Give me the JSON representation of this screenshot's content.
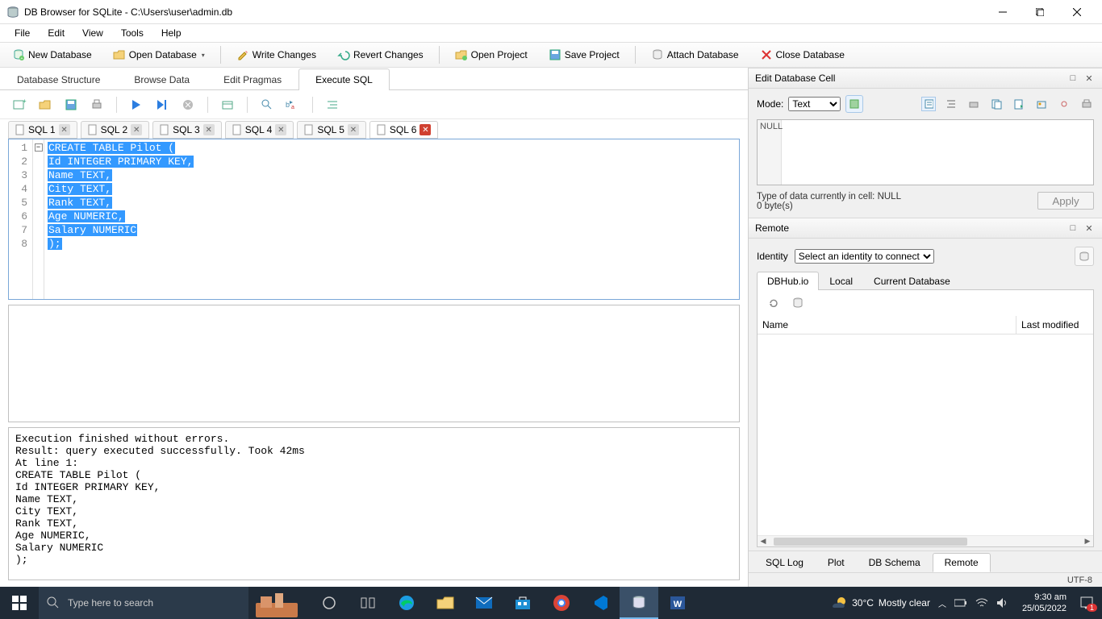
{
  "window": {
    "title": "DB Browser for SQLite - C:\\Users\\user\\admin.db"
  },
  "menu": {
    "file": "File",
    "edit": "Edit",
    "view": "View",
    "tools": "Tools",
    "help": "Help"
  },
  "toolbar": {
    "new_db": "New Database",
    "open_db": "Open Database",
    "write_changes": "Write Changes",
    "revert_changes": "Revert Changes",
    "open_project": "Open Project",
    "save_project": "Save Project",
    "attach_db": "Attach Database",
    "close_db": "Close Database"
  },
  "main_tabs": {
    "structure": "Database Structure",
    "browse": "Browse Data",
    "pragmas": "Edit Pragmas",
    "execute": "Execute SQL"
  },
  "sql_tabs": [
    {
      "label": "SQL 1"
    },
    {
      "label": "SQL 2"
    },
    {
      "label": "SQL 3"
    },
    {
      "label": "SQL 4"
    },
    {
      "label": "SQL 5"
    },
    {
      "label": "SQL 6"
    }
  ],
  "editor": {
    "lines": [
      "1",
      "2",
      "3",
      "4",
      "5",
      "6",
      "7",
      "8"
    ],
    "l1": "CREATE TABLE Pilot (",
    "l2": "Id INTEGER PRIMARY KEY,",
    "l3": "Name TEXT,",
    "l4": "City TEXT,",
    "l5": "Rank TEXT,",
    "l6": "Age NUMERIC,",
    "l7": "Salary NUMERIC",
    "l8": ");"
  },
  "output": "Execution finished without errors.\nResult: query executed successfully. Took 42ms\nAt line 1:\nCREATE TABLE Pilot (\nId INTEGER PRIMARY KEY,\nName TEXT,\nCity TEXT,\nRank TEXT,\nAge NUMERIC,\nSalary NUMERIC\n);",
  "edit_cell": {
    "title": "Edit Database Cell",
    "mode_label": "Mode:",
    "mode_value": "Text",
    "null_tag": "NULL",
    "type_info": "Type of data currently in cell: NULL",
    "size_info": "0 byte(s)",
    "apply": "Apply"
  },
  "remote": {
    "title": "Remote",
    "identity_label": "Identity",
    "identity_value": "Select an identity to connect",
    "tabs": {
      "dbhub": "DBHub.io",
      "local": "Local",
      "current": "Current Database"
    },
    "col_name": "Name",
    "col_mod": "Last modified"
  },
  "bottom_tabs": {
    "sql_log": "SQL Log",
    "plot": "Plot",
    "db_schema": "DB Schema",
    "remote": "Remote"
  },
  "status": {
    "encoding": "UTF-8"
  },
  "taskbar": {
    "search_placeholder": "Type here to search",
    "weather_temp": "30°C",
    "weather_text": "Mostly clear",
    "time": "9:30 am",
    "date": "25/05/2022",
    "notif_count": "1"
  }
}
